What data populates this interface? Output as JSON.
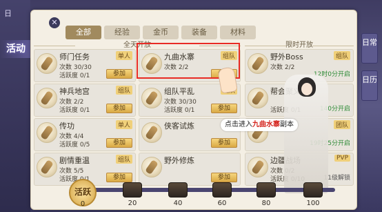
{
  "left": {
    "title": "活动",
    "chars": [
      "日"
    ]
  },
  "tabs": [
    "全部",
    "经验",
    "金币",
    "装备",
    "材料"
  ],
  "sections": {
    "all_day": "全天开放",
    "limited": "限时开放"
  },
  "cards": [
    {
      "name": "师门任务",
      "tag": "单人",
      "line1": "次数 30/30",
      "line2": "活跃度 0/1",
      "button": "参加",
      "timer": "",
      "info": ""
    },
    {
      "name": "九曲水寨",
      "tag": "组队",
      "line1": "次数 2/2",
      "line2": "",
      "button": "参加",
      "timer": "",
      "info": ""
    },
    {
      "name": "野外Boss",
      "tag": "组队",
      "line1": "次数 2/2",
      "line2": "",
      "button": "",
      "timer": "12时0分开启",
      "info": ""
    },
    {
      "name": "神兵地宫",
      "tag": "组队",
      "line1": "次数 2/2",
      "line2": "活跃度 0/1",
      "button": "参加",
      "timer": "",
      "info": ""
    },
    {
      "name": "组队平乱",
      "tag": "组队",
      "line1": "次数 30/30",
      "line2": "活跃度 0/1",
      "button": "参加",
      "timer": "",
      "info": ""
    },
    {
      "name": "帮会聚义",
      "tag": "",
      "line1": "",
      "line2": "活跃度 0/1",
      "button": "",
      "timer": "140分开启",
      "info": ""
    },
    {
      "name": "传功",
      "tag": "单人",
      "line1": "次数 4/4",
      "line2": "活跃度 0/5",
      "button": "参加",
      "timer": "",
      "info": ""
    },
    {
      "name": "侠客试炼",
      "tag": "",
      "line1": "",
      "line2": "",
      "button": "参加",
      "timer": "",
      "info": ""
    },
    {
      "name": "",
      "tag": "团队",
      "line1": "",
      "line2": "",
      "button": "",
      "timer": "19时25分开启",
      "info": ""
    },
    {
      "name": "剧情重温",
      "tag": "组队",
      "line1": "次数 5/5",
      "line2": "活跃度 0/1",
      "button": "参加",
      "timer": "",
      "info": ""
    },
    {
      "name": "野外修炼",
      "tag": "",
      "line1": "",
      "line2": "",
      "button": "参加",
      "timer": "",
      "info": ""
    },
    {
      "name": "边疆战场",
      "tag": "PVP",
      "line1": "次数 0/2",
      "line2": "活跃度 0/10",
      "button": "",
      "timer": "",
      "info": "11级解锁"
    }
  ],
  "tooltip": {
    "prefix": "点击进入",
    "highlight": "九曲水寨",
    "suffix": "副本"
  },
  "right_tabs": [
    "日常",
    "日历"
  ],
  "activity": {
    "label": "活跃",
    "value": "0",
    "milestones": [
      "20",
      "40",
      "60",
      "80",
      "100"
    ]
  }
}
